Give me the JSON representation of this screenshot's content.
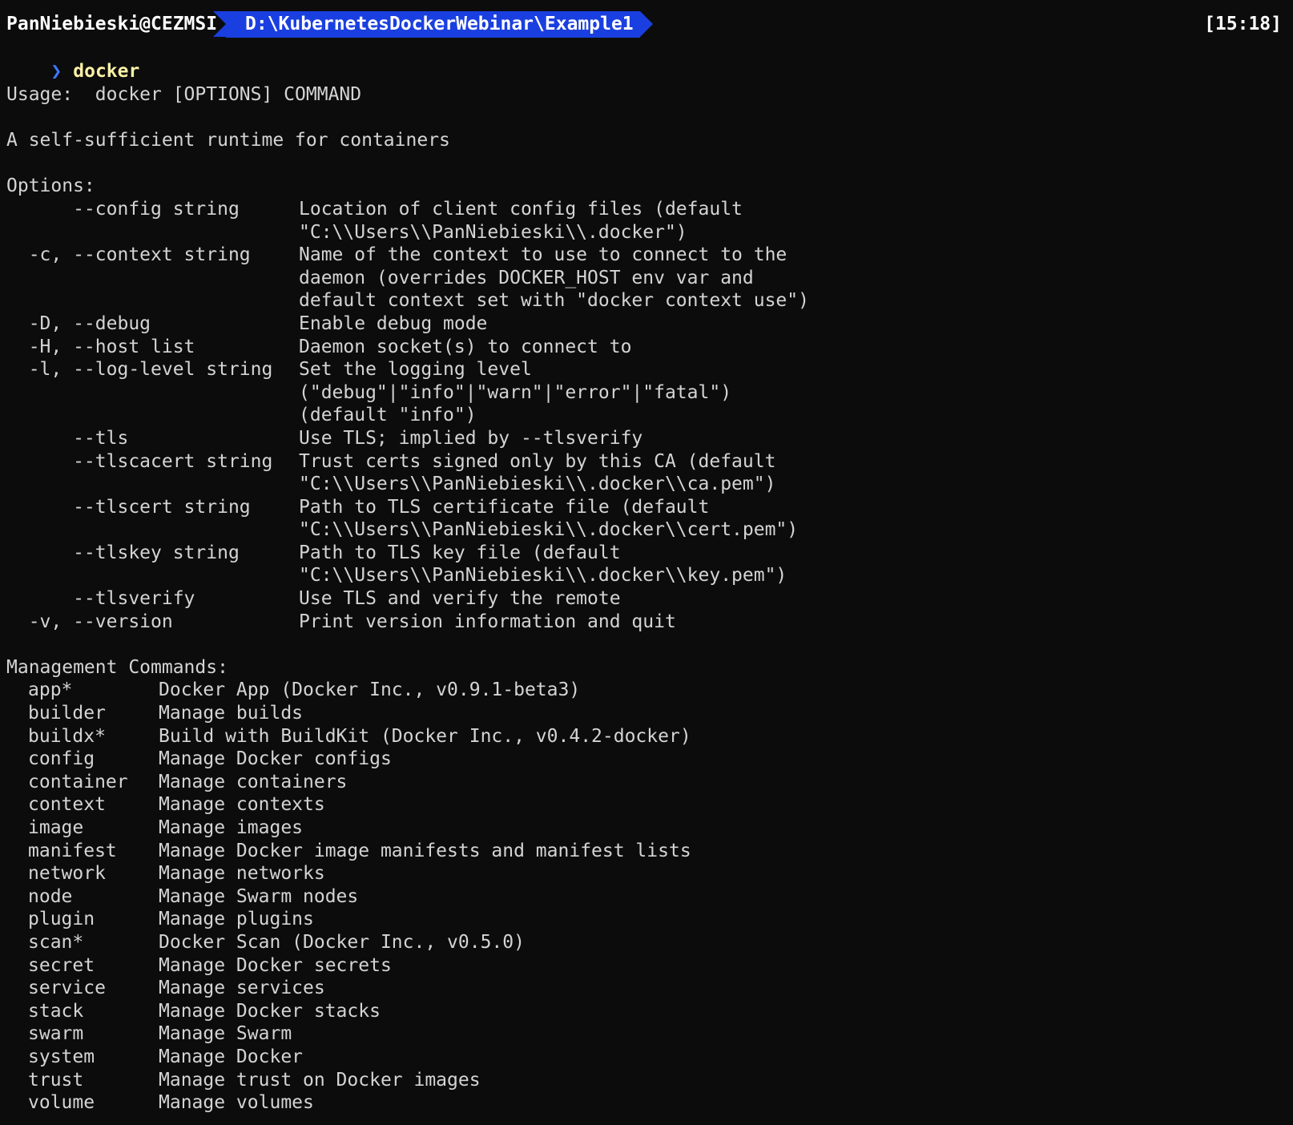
{
  "prompt": {
    "user_host": "PanNiebieski@CEZMSI",
    "path": "D:\\KubernetesDockerWebinar\\Example1",
    "time": "[15:18]",
    "chevron": "❯",
    "command": "docker"
  },
  "usage_line": "Usage:  docker [OPTIONS] COMMAND",
  "tagline": "A self-sufficient runtime for containers",
  "options_header": "Options:",
  "options": [
    {
      "flag": "      --config string",
      "desc": "Location of client config files (default"
    },
    {
      "flag": "",
      "desc": "\"C:\\\\Users\\\\PanNiebieski\\\\.docker\")"
    },
    {
      "flag": "  -c, --context string",
      "desc": "Name of the context to use to connect to the"
    },
    {
      "flag": "",
      "desc": "daemon (overrides DOCKER_HOST env var and"
    },
    {
      "flag": "",
      "desc": "default context set with \"docker context use\")"
    },
    {
      "flag": "  -D, --debug",
      "desc": "Enable debug mode"
    },
    {
      "flag": "  -H, --host list",
      "desc": "Daemon socket(s) to connect to"
    },
    {
      "flag": "  -l, --log-level string",
      "desc": "Set the logging level"
    },
    {
      "flag": "",
      "desc": "(\"debug\"|\"info\"|\"warn\"|\"error\"|\"fatal\")"
    },
    {
      "flag": "",
      "desc": "(default \"info\")"
    },
    {
      "flag": "      --tls",
      "desc": "Use TLS; implied by --tlsverify"
    },
    {
      "flag": "      --tlscacert string",
      "desc": "Trust certs signed only by this CA (default"
    },
    {
      "flag": "",
      "desc": "\"C:\\\\Users\\\\PanNiebieski\\\\.docker\\\\ca.pem\")"
    },
    {
      "flag": "      --tlscert string",
      "desc": "Path to TLS certificate file (default"
    },
    {
      "flag": "",
      "desc": "\"C:\\\\Users\\\\PanNiebieski\\\\.docker\\\\cert.pem\")"
    },
    {
      "flag": "      --tlskey string",
      "desc": "Path to TLS key file (default"
    },
    {
      "flag": "",
      "desc": "\"C:\\\\Users\\\\PanNiebieski\\\\.docker\\\\key.pem\")"
    },
    {
      "flag": "      --tlsverify",
      "desc": "Use TLS and verify the remote"
    },
    {
      "flag": "  -v, --version",
      "desc": "Print version information and quit"
    }
  ],
  "mgmt_header": "Management Commands:",
  "commands": [
    {
      "name": "app*",
      "desc": "Docker App (Docker Inc., v0.9.1-beta3)"
    },
    {
      "name": "builder",
      "desc": "Manage builds"
    },
    {
      "name": "buildx*",
      "desc": "Build with BuildKit (Docker Inc., v0.4.2-docker)"
    },
    {
      "name": "config",
      "desc": "Manage Docker configs"
    },
    {
      "name": "container",
      "desc": "Manage containers"
    },
    {
      "name": "context",
      "desc": "Manage contexts"
    },
    {
      "name": "image",
      "desc": "Manage images"
    },
    {
      "name": "manifest",
      "desc": "Manage Docker image manifests and manifest lists"
    },
    {
      "name": "network",
      "desc": "Manage networks"
    },
    {
      "name": "node",
      "desc": "Manage Swarm nodes"
    },
    {
      "name": "plugin",
      "desc": "Manage plugins"
    },
    {
      "name": "scan*",
      "desc": "Docker Scan (Docker Inc., v0.5.0)"
    },
    {
      "name": "secret",
      "desc": "Manage Docker secrets"
    },
    {
      "name": "service",
      "desc": "Manage services"
    },
    {
      "name": "stack",
      "desc": "Manage Docker stacks"
    },
    {
      "name": "swarm",
      "desc": "Manage Swarm"
    },
    {
      "name": "system",
      "desc": "Manage Docker"
    },
    {
      "name": "trust",
      "desc": "Manage trust on Docker images"
    },
    {
      "name": "volume",
      "desc": "Manage volumes"
    }
  ]
}
